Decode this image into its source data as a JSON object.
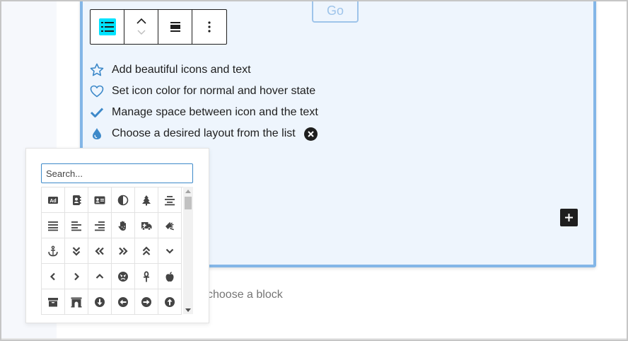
{
  "go_button": {
    "label": "Go"
  },
  "toolbar": {
    "items": [
      {
        "name": "icon-list-block",
        "icon": "list-icon",
        "accent": "#00e3ff"
      },
      {
        "name": "move-block",
        "icon": "chevron-up-down-icon"
      },
      {
        "name": "align",
        "icon": "align-icon"
      },
      {
        "name": "more-options",
        "icon": "vertical-ellipsis-icon"
      }
    ]
  },
  "features": [
    {
      "icon": "star-outline-icon",
      "text": "Add beautiful icons and text"
    },
    {
      "icon": "heart-outline-icon",
      "text": "Set icon color for normal and hover state"
    },
    {
      "icon": "check-icon",
      "text": "Manage space between icon and the text"
    },
    {
      "icon": "droplet-icon",
      "text": "Choose a desired layout from the list"
    }
  ],
  "icon_color": "#3d89c9",
  "add_block": {
    "icon": "plus-icon"
  },
  "block_placeholder": "choose a block",
  "icon_picker": {
    "search_placeholder": "Search...",
    "rows": [
      [
        "ad-icon",
        "address-book-icon",
        "address-card-icon",
        "adjust-icon",
        "tree-icon",
        "align-center-icon"
      ],
      [
        "align-justify-icon",
        "align-left-icon",
        "align-right-icon",
        "allergies-icon",
        "ambulance-icon",
        "american-sign-language-icon"
      ],
      [
        "anchor-icon",
        "angle-double-down-icon",
        "angle-double-left-icon",
        "angle-double-right-icon",
        "angle-double-up-icon",
        "angle-down-icon"
      ],
      [
        "angle-left-icon",
        "angle-right-icon",
        "angle-up-icon",
        "angry-icon",
        "ankh-icon",
        "apple-icon"
      ],
      [
        "archive-icon",
        "archway-icon",
        "arrow-circle-down-icon",
        "arrow-circle-left-icon",
        "arrow-circle-right-icon",
        "arrow-circle-up-icon"
      ]
    ]
  },
  "colors": {
    "block_border": "#83b6e7",
    "block_bg": "#eef5fd",
    "accent": "#3d89c9",
    "dark": "#1e1e1e"
  }
}
